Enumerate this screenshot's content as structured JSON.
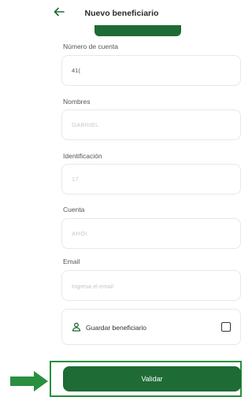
{
  "header": {
    "title": "Nuevo beneficiario",
    "back_icon": "arrow-left-icon"
  },
  "form": {
    "account_number": {
      "label": "Número de cuenta",
      "value": "41("
    },
    "names": {
      "label": "Nombres",
      "value": "GABRIEL"
    },
    "identification": {
      "label": "Identificación",
      "value": "17"
    },
    "account": {
      "label": "Cuenta",
      "value": "AHOI"
    },
    "email": {
      "label": "Email",
      "placeholder": "Ingresa el email",
      "value": ""
    }
  },
  "save_beneficiary": {
    "label": "Guardar beneficiario",
    "icon": "person-icon",
    "checked": false
  },
  "actions": {
    "validate_label": "Validar"
  },
  "colors": {
    "primary": "#1e6b35",
    "highlight": "#2a8f3f"
  }
}
